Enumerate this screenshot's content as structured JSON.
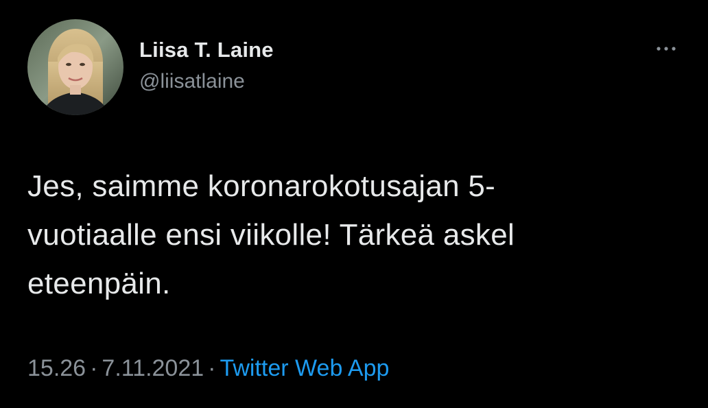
{
  "tweet": {
    "author": {
      "display_name": "Liisa T. Laine",
      "handle": "@liisatlaine",
      "avatar_icon": "profile-photo"
    },
    "menu_icon": "more-horizontal-icon",
    "text": "Jes, saimme koronarokotusajan 5-\nvuotiaalle ensi viikolle! Tärkeä askel\neteenpäin.",
    "time": "15.26",
    "separator": "·",
    "date": "7.11.2021",
    "source": "Twitter Web App"
  },
  "colors": {
    "background": "#000000",
    "primary_text": "#e7e9ea",
    "secondary_text": "#8b9299",
    "link": "#1d9bf0"
  }
}
